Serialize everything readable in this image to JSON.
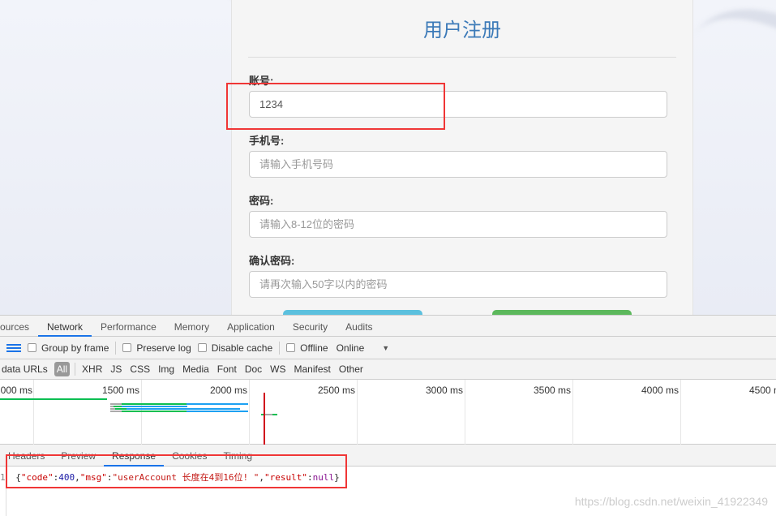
{
  "form": {
    "title": "用户注册",
    "fields": [
      {
        "label": "账号:",
        "value": "1234",
        "placeholder": ""
      },
      {
        "label": "手机号:",
        "value": "",
        "placeholder": "请输入手机号码"
      },
      {
        "label": "密码:",
        "value": "",
        "placeholder": "请输入8-12位的密码"
      },
      {
        "label": "确认密码:",
        "value": "",
        "placeholder": "请再次输入50字以内的密码"
      }
    ],
    "colors": {
      "title": "#3c7ab8",
      "button_primary": "#5bc0de",
      "button_success": "#5cb85c"
    }
  },
  "devtools": {
    "tabs": [
      "ources",
      "Network",
      "Performance",
      "Memory",
      "Application",
      "Security",
      "Audits"
    ],
    "active_tab": "Network",
    "toolbar": {
      "group_by_frame": "Group by frame",
      "preserve_log": "Preserve log",
      "disable_cache": "Disable cache",
      "offline": "Offline",
      "throttle": "Online"
    },
    "filters": [
      "data URLs",
      "All",
      "XHR",
      "JS",
      "CSS",
      "Img",
      "Media",
      "Font",
      "Doc",
      "WS",
      "Manifest",
      "Other"
    ],
    "timeline_ticks": [
      "000 ms",
      "1500 ms",
      "2000 ms",
      "2500 ms",
      "3000 ms",
      "3500 ms",
      "4000 ms",
      "4500 ms"
    ],
    "detail_tabs": [
      "Headers",
      "Preview",
      "Response",
      "Cookies",
      "Timing"
    ],
    "active_detail_tab": "Response",
    "response": {
      "line_no": "1",
      "t1": "{",
      "k1": "\"code\"",
      "c1": ":",
      "v1": "400",
      "c2": ",",
      "k2": "\"msg\"",
      "c3": ":",
      "v2": "\"userAccount 长度在4到16位! \"",
      "c4": ",",
      "k3": "\"result\"",
      "c5": ":",
      "v3": "null",
      "t2": "}"
    }
  },
  "watermark": "https://blog.csdn.net/weixin_41922349"
}
